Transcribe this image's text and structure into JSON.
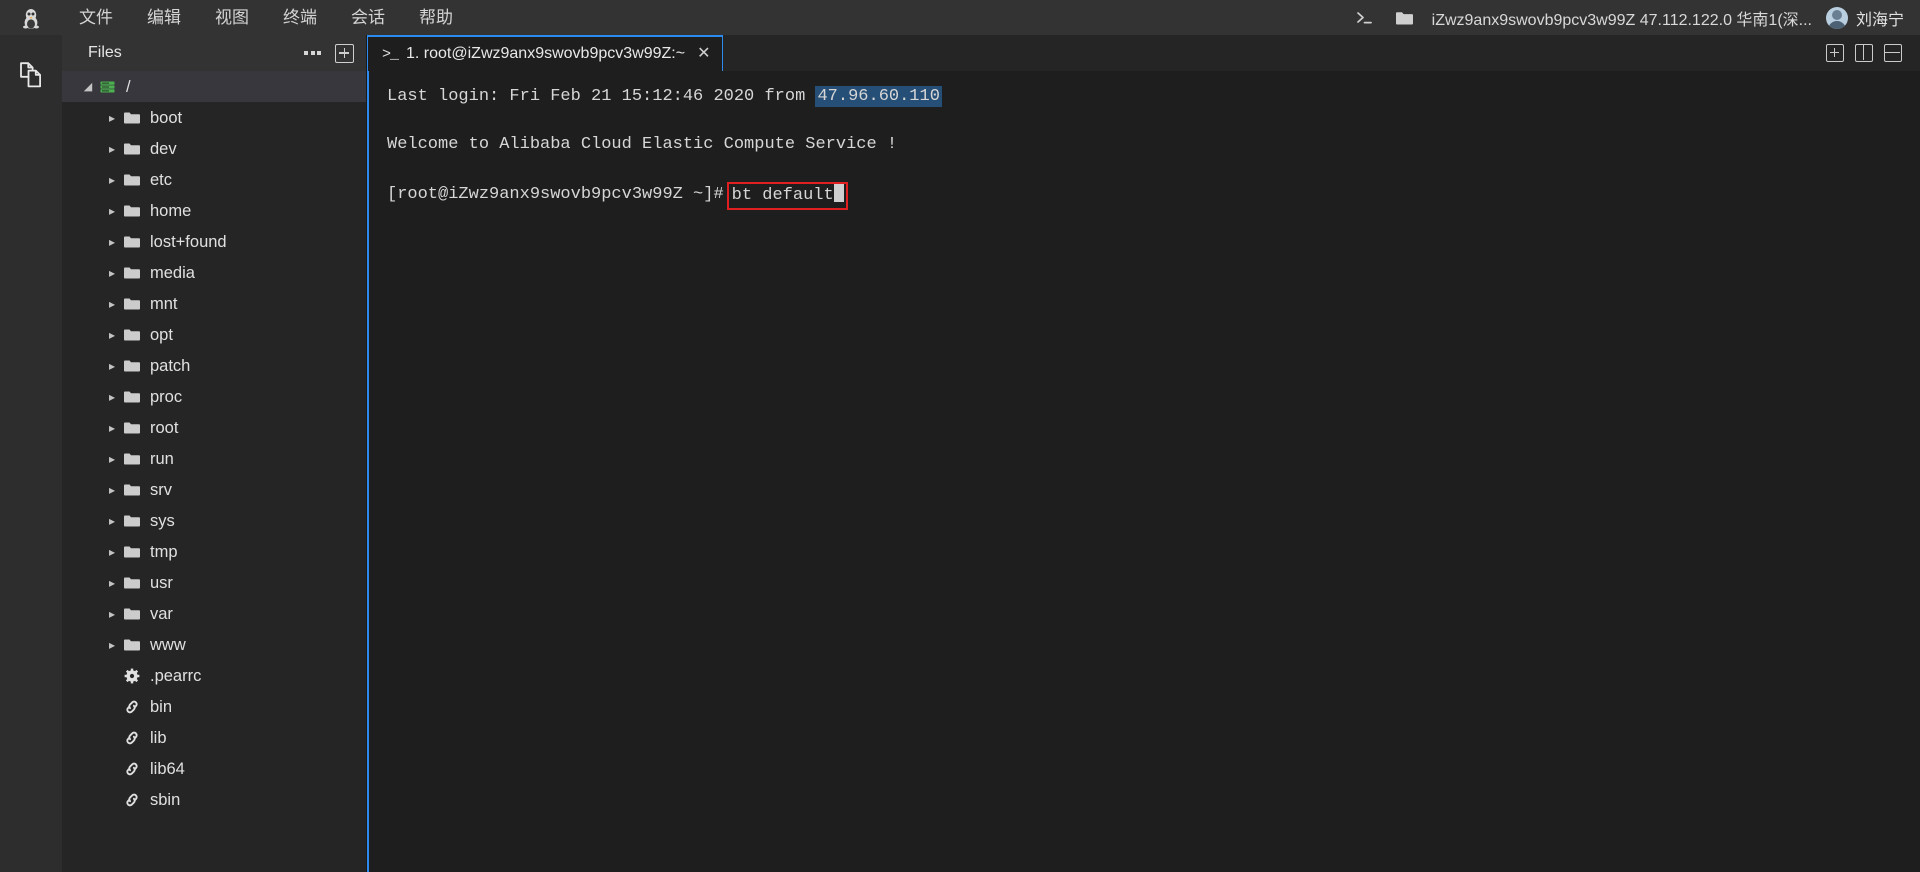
{
  "menubar": {
    "logo_icon": "linux-penguin-icon",
    "items": [
      {
        "label": "文件",
        "name": "menu-file"
      },
      {
        "label": "编辑",
        "name": "menu-edit"
      },
      {
        "label": "视图",
        "name": "menu-view"
      },
      {
        "label": "终端",
        "name": "menu-terminal"
      },
      {
        "label": "会话",
        "name": "menu-session"
      },
      {
        "label": "帮助",
        "name": "menu-help"
      }
    ],
    "right": {
      "terminal_icon": "prompt-icon",
      "folder_icon": "folder-icon",
      "connection_title": "iZwz9anx9swovb9pcv3w99Z 47.112.122.0 华南1(深...",
      "user_name": "刘海宁",
      "avatar_icon": "user-avatar-icon"
    }
  },
  "activitybar": {
    "items": [
      {
        "name": "activity-files-icon",
        "icon": "files-copy-icon"
      }
    ]
  },
  "sidebar": {
    "title": "Files",
    "more_icon": "more-options-icon",
    "add_icon": "add-icon",
    "tree": [
      {
        "label": "/",
        "icon": "server-icon",
        "type": "root",
        "expanded": true,
        "selected": true
      },
      {
        "label": "boot",
        "icon": "folder-icon",
        "type": "folder"
      },
      {
        "label": "dev",
        "icon": "folder-icon",
        "type": "folder"
      },
      {
        "label": "etc",
        "icon": "folder-icon",
        "type": "folder"
      },
      {
        "label": "home",
        "icon": "folder-icon",
        "type": "folder"
      },
      {
        "label": "lost+found",
        "icon": "folder-icon",
        "type": "folder"
      },
      {
        "label": "media",
        "icon": "folder-icon",
        "type": "folder"
      },
      {
        "label": "mnt",
        "icon": "folder-icon",
        "type": "folder"
      },
      {
        "label": "opt",
        "icon": "folder-icon",
        "type": "folder"
      },
      {
        "label": "patch",
        "icon": "folder-icon",
        "type": "folder"
      },
      {
        "label": "proc",
        "icon": "folder-icon",
        "type": "folder"
      },
      {
        "label": "root",
        "icon": "folder-icon",
        "type": "folder"
      },
      {
        "label": "run",
        "icon": "folder-icon",
        "type": "folder"
      },
      {
        "label": "srv",
        "icon": "folder-icon",
        "type": "folder"
      },
      {
        "label": "sys",
        "icon": "folder-icon",
        "type": "folder"
      },
      {
        "label": "tmp",
        "icon": "folder-icon",
        "type": "folder"
      },
      {
        "label": "usr",
        "icon": "folder-icon",
        "type": "folder"
      },
      {
        "label": "var",
        "icon": "folder-icon",
        "type": "folder"
      },
      {
        "label": "www",
        "icon": "folder-icon",
        "type": "folder"
      },
      {
        "label": ".pearrc",
        "icon": "gear-icon",
        "type": "config"
      },
      {
        "label": "bin",
        "icon": "link-icon",
        "type": "symlink"
      },
      {
        "label": "lib",
        "icon": "link-icon",
        "type": "symlink"
      },
      {
        "label": "lib64",
        "icon": "link-icon",
        "type": "symlink"
      },
      {
        "label": "sbin",
        "icon": "link-icon",
        "type": "symlink"
      }
    ]
  },
  "terminal": {
    "tab": {
      "prompt_icon": "prompt-icon",
      "label": "1. root@iZwz9anx9swovb9pcv3w99Z:~",
      "close_icon": "close-icon"
    },
    "tabbar_actions": [
      {
        "name": "new-tab-button",
        "icon": "add-icon"
      },
      {
        "name": "split-vertical-button",
        "icon": "split-vertical-icon"
      },
      {
        "name": "split-horizontal-button",
        "icon": "split-horizontal-icon"
      }
    ],
    "lines": {
      "last_login_prefix": "Last login: Fri Feb 21 15:12:46 2020 from ",
      "last_login_ip": "47.96.60.110",
      "welcome": "Welcome to Alibaba Cloud Elastic Compute Service !",
      "prompt": "[root@iZwz9anx9swovb9pcv3w99Z ~]#",
      "command": "bt default"
    }
  },
  "colors": {
    "accent_blue": "#2d8bf0",
    "annotation_red": "#e02020",
    "terminal_bg": "#1e1e1e",
    "sidebar_bg": "#252526",
    "menubar_bg": "#333333",
    "selection_bg": "#264f78",
    "root_icon_green": "#4caf50"
  }
}
